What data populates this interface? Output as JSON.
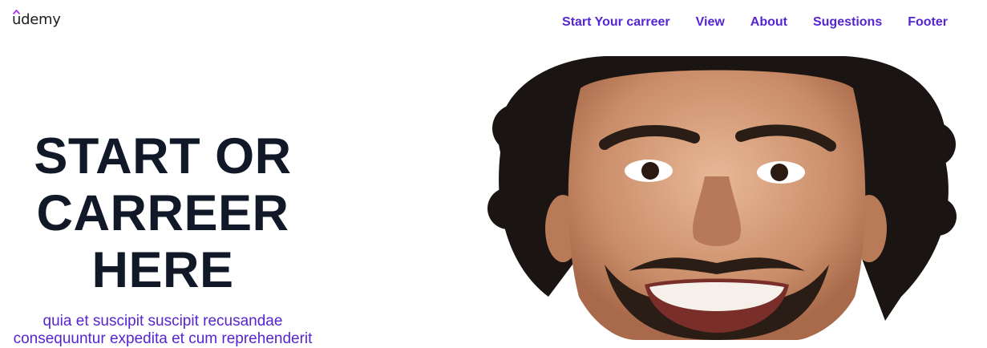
{
  "brand": {
    "logo_text": "udemy"
  },
  "nav": {
    "links": [
      {
        "label": "Start Your carreer"
      },
      {
        "label": "View"
      },
      {
        "label": "About"
      },
      {
        "label": "Sugestions"
      },
      {
        "label": "Footer"
      }
    ]
  },
  "hero": {
    "title_lines": [
      "START OR",
      "CARREER",
      "HERE"
    ],
    "description_lines": [
      "quia et suscipit suscipit recusandae",
      "consequuntur expedita et cum reprehenderit"
    ]
  },
  "colors": {
    "accent": "#5624d0",
    "title": "#111827",
    "logo_hat": "#a435f0"
  },
  "icons": {
    "logo_mark": "udemy-hat-icon"
  }
}
